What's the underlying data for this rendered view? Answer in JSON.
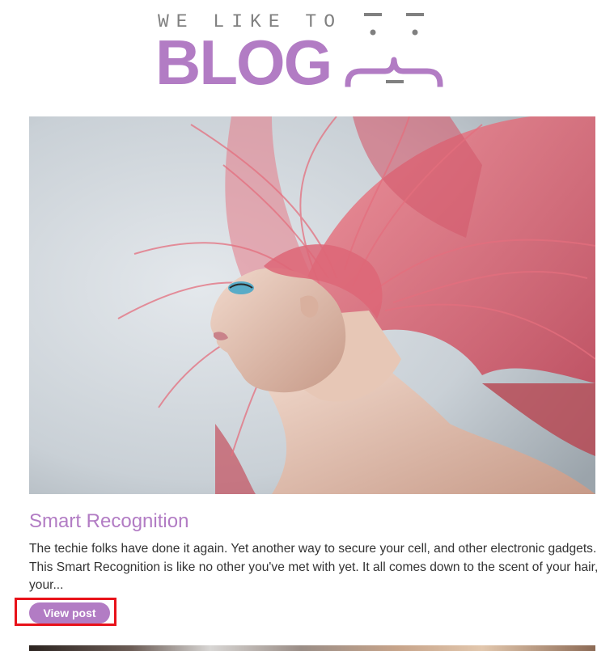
{
  "site": {
    "logo_tagline": "WE LIKE TO",
    "logo_word": "BLOG",
    "logo_alt": "We Like To Blog logo"
  },
  "colors": {
    "brand_purple": "#b27cc4",
    "logo_gray": "#808080",
    "body_text": "#333333",
    "highlight_red": "#e8121a"
  },
  "posts": [
    {
      "image": "woman-with-pink-hair-photo",
      "title": "Smart Recognition",
      "excerpt": "The techie folks have done it again. Yet another way to secure your cell, and other electronic gadgets. This Smart Recognition is like no other you've met with yet. It all comes down to the scent of your hair, your...",
      "cta_label": "View post"
    }
  ]
}
